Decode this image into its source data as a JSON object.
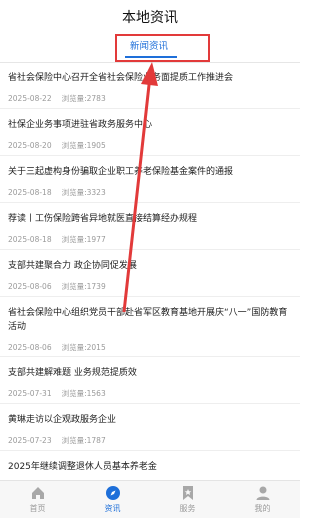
{
  "header": {
    "title": "本地资讯"
  },
  "tabs": [
    {
      "label": "新闻资讯"
    }
  ],
  "views_label": "浏览量:",
  "news": [
    {
      "title": "省社会保险中心召开全省社会保险业务面提质工作推进会",
      "date": "2025-08-22",
      "views": "2783"
    },
    {
      "title": "社保企业务事项进驻省政务服务中心",
      "date": "2025-08-20",
      "views": "1905"
    },
    {
      "title": "关于三起虚构身份骗取企业职工养老保险基金案件的通报",
      "date": "2025-08-18",
      "views": "3323"
    },
    {
      "title": "荐读丨工伤保险跨省异地就医直接结算经办规程",
      "date": "2025-08-18",
      "views": "1977"
    },
    {
      "title": "支部共建聚合力 政企协同促发展",
      "date": "2025-08-06",
      "views": "1739"
    },
    {
      "title": "省社会保险中心组织党员干部赴省军区教育基地开展庆“八一”国防教育活动",
      "date": "2025-08-06",
      "views": "2015"
    },
    {
      "title": "支部共建解难题 业务规范提质效",
      "date": "2025-07-31",
      "views": "1563"
    },
    {
      "title": "黄琳走访以企观政服务企业",
      "date": "2025-07-23",
      "views": "1787"
    },
    {
      "title": "2025年继续调整退休人员基本养老金",
      "date": "",
      "views": ""
    }
  ],
  "nav": [
    {
      "label": "首页",
      "icon": "home-icon"
    },
    {
      "label": "资讯",
      "icon": "compass-icon"
    },
    {
      "label": "服务",
      "icon": "bookmark-icon"
    },
    {
      "label": "我的",
      "icon": "user-icon"
    }
  ],
  "colors": {
    "accent": "#1e6fd9",
    "annotation": "#e23a3a"
  }
}
